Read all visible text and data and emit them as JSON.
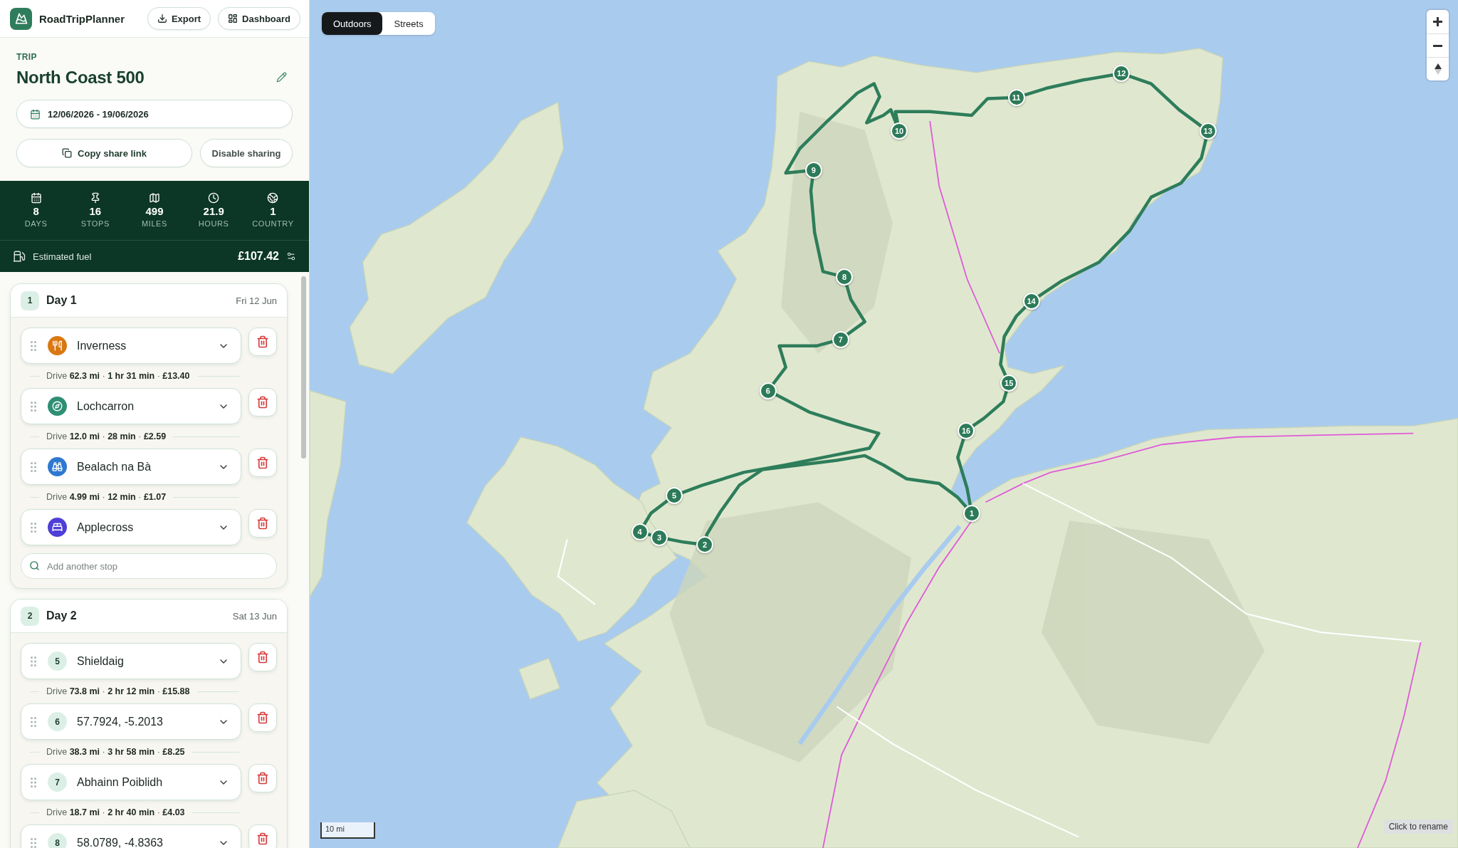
{
  "header": {
    "brand": "RoadTripPlanner",
    "buttons": [
      {
        "kind": "export",
        "label": "Export"
      },
      {
        "kind": "dashboard",
        "label": "Dashboard"
      }
    ]
  },
  "trip": {
    "eyebrow": "TRIP",
    "title": "North Coast 500",
    "dates": "12/06/2026 - 19/06/2026",
    "actions": [
      {
        "kind": "copy",
        "label": "Copy share link"
      },
      {
        "kind": "plain",
        "label": "Disable sharing"
      }
    ]
  },
  "stats": [
    {
      "kind": "calendar",
      "value": "8",
      "label": "DAYS"
    },
    {
      "kind": "pin",
      "value": "16",
      "label": "STOPS"
    },
    {
      "kind": "map",
      "value": "499",
      "label": "MILES"
    },
    {
      "kind": "clock",
      "value": "21.9",
      "label": "HOURS"
    },
    {
      "kind": "globe",
      "value": "1",
      "label": "COUNTRY"
    }
  ],
  "fuel": {
    "label": "Estimated fuel",
    "value": "£107.42"
  },
  "days": [
    {
      "number": "1",
      "title": "Day 1",
      "date": "Fri 12 Jun",
      "stops": [
        {
          "kind": "food",
          "color": "#d97812",
          "name": "Inverness",
          "drive": "Drive **62.3 mi** · **1 hr 31 min** · **£13.40**"
        },
        {
          "kind": "viewpoint",
          "color": "#2f8f73",
          "name": "Lochcarron",
          "drive": "Drive **12.0 mi** · **28 min** · **£2.59**"
        },
        {
          "kind": "sight",
          "color": "#2f78d0",
          "name": "Bealach na Bà",
          "drive": "Drive **4.99 mi** · **12 min** · **£1.07**"
        },
        {
          "kind": "lodging",
          "color": "#4f3fd6",
          "name": "Applecross"
        }
      ],
      "add_stop": {
        "placeholder": "Add another stop"
      }
    },
    {
      "number": "2",
      "title": "Day 2",
      "date": "Sat 13 Jun",
      "stops": [
        {
          "kind": "numbered",
          "number": "5",
          "name": "Shieldaig",
          "drive": "Drive **73.8 mi** · **2 hr 12 min** · **£15.88**"
        },
        {
          "kind": "numbered",
          "number": "6",
          "name": "57.7924, -5.2013",
          "drive": "Drive **38.3 mi** · **3 hr 58 min** · **£8.25**"
        },
        {
          "kind": "numbered",
          "number": "7",
          "name": "Abhainn Poiblidh",
          "drive": "Drive **18.7 mi** · **2 hr 40 min** · **£4.03**"
        },
        {
          "kind": "numbered",
          "number": "8",
          "name": "58.0789, -4.8363"
        }
      ]
    }
  ],
  "map": {
    "styles": [
      {
        "label": "Outdoors",
        "selected": true
      },
      {
        "label": "Streets",
        "selected": false
      }
    ],
    "markers": [
      {
        "label": "1"
      },
      {
        "label": "2"
      },
      {
        "label": "3"
      },
      {
        "label": "4"
      },
      {
        "label": "5"
      },
      {
        "label": "6"
      },
      {
        "label": "7"
      },
      {
        "label": "8"
      },
      {
        "label": "9"
      },
      {
        "label": "10"
      },
      {
        "label": "11"
      },
      {
        "label": "12"
      },
      {
        "label": "13"
      },
      {
        "label": "14"
      },
      {
        "label": "15"
      },
      {
        "label": "16"
      }
    ],
    "scale": "10 mi",
    "tooltip": "Click to rename"
  }
}
